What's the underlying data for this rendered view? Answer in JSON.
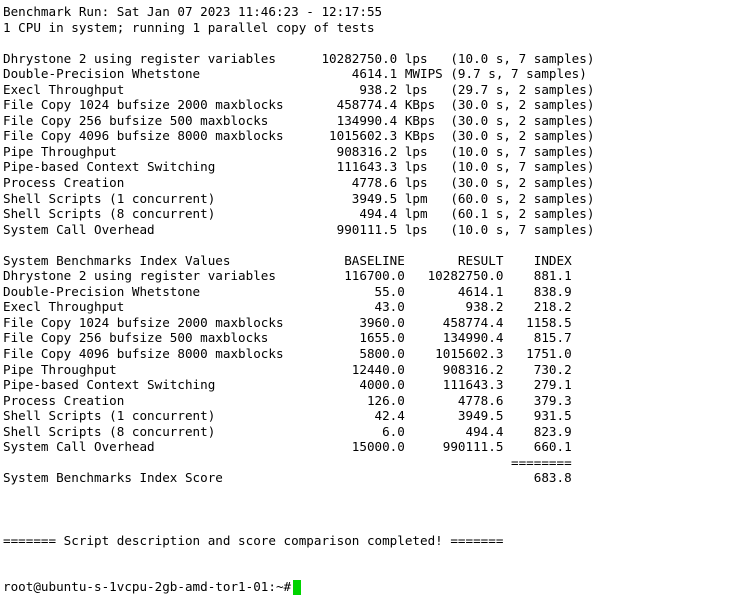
{
  "header": {
    "title": "Benchmark Run: Sat Jan 07 2023 11:46:23 - 12:17:55",
    "system": "1 CPU in system; running 1 parallel copy of tests"
  },
  "results": [
    {
      "name": "Dhrystone 2 using register variables",
      "value": "10282750.0",
      "unit": "lps",
      "meta": "(10.0 s, 7 samples)"
    },
    {
      "name": "Double-Precision Whetstone",
      "value": "4614.1",
      "unit": "MWIPS",
      "meta": "(9.7 s, 7 samples)"
    },
    {
      "name": "Execl Throughput",
      "value": "938.2",
      "unit": "lps",
      "meta": "(29.7 s, 2 samples)"
    },
    {
      "name": "File Copy 1024 bufsize 2000 maxblocks",
      "value": "458774.4",
      "unit": "KBps",
      "meta": "(30.0 s, 2 samples)"
    },
    {
      "name": "File Copy 256 bufsize 500 maxblocks",
      "value": "134990.4",
      "unit": "KBps",
      "meta": "(30.0 s, 2 samples)"
    },
    {
      "name": "File Copy 4096 bufsize 8000 maxblocks",
      "value": "1015602.3",
      "unit": "KBps",
      "meta": "(30.0 s, 2 samples)"
    },
    {
      "name": "Pipe Throughput",
      "value": "908316.2",
      "unit": "lps",
      "meta": "(10.0 s, 7 samples)"
    },
    {
      "name": "Pipe-based Context Switching",
      "value": "111643.3",
      "unit": "lps",
      "meta": "(10.0 s, 7 samples)"
    },
    {
      "name": "Process Creation",
      "value": "4778.6",
      "unit": "lps",
      "meta": "(30.0 s, 2 samples)"
    },
    {
      "name": "Shell Scripts (1 concurrent)",
      "value": "3949.5",
      "unit": "lpm",
      "meta": "(60.0 s, 2 samples)"
    },
    {
      "name": "Shell Scripts (8 concurrent)",
      "value": "494.4",
      "unit": "lpm",
      "meta": "(60.1 s, 2 samples)"
    },
    {
      "name": "System Call Overhead",
      "value": "990111.5",
      "unit": "lps",
      "meta": "(10.0 s, 7 samples)"
    }
  ],
  "index_table": {
    "title": "System Benchmarks Index Values",
    "col_baseline": "BASELINE",
    "col_result": "RESULT",
    "col_index": "INDEX",
    "rows": [
      {
        "name": "Dhrystone 2 using register variables",
        "baseline": "116700.0",
        "result": "10282750.0",
        "index": "881.1"
      },
      {
        "name": "Double-Precision Whetstone",
        "baseline": "55.0",
        "result": "4614.1",
        "index": "838.9"
      },
      {
        "name": "Execl Throughput",
        "baseline": "43.0",
        "result": "938.2",
        "index": "218.2"
      },
      {
        "name": "File Copy 1024 bufsize 2000 maxblocks",
        "baseline": "3960.0",
        "result": "458774.4",
        "index": "1158.5"
      },
      {
        "name": "File Copy 256 bufsize 500 maxblocks",
        "baseline": "1655.0",
        "result": "134990.4",
        "index": "815.7"
      },
      {
        "name": "File Copy 4096 bufsize 8000 maxblocks",
        "baseline": "5800.0",
        "result": "1015602.3",
        "index": "1751.0"
      },
      {
        "name": "Pipe Throughput",
        "baseline": "12440.0",
        "result": "908316.2",
        "index": "730.2"
      },
      {
        "name": "Pipe-based Context Switching",
        "baseline": "4000.0",
        "result": "111643.3",
        "index": "279.1"
      },
      {
        "name": "Process Creation",
        "baseline": "126.0",
        "result": "4778.6",
        "index": "379.3"
      },
      {
        "name": "Shell Scripts (1 concurrent)",
        "baseline": "42.4",
        "result": "3949.5",
        "index": "931.5"
      },
      {
        "name": "Shell Scripts (8 concurrent)",
        "baseline": "6.0",
        "result": "494.4",
        "index": "823.9"
      },
      {
        "name": "System Call Overhead",
        "baseline": "15000.0",
        "result": "990111.5",
        "index": "660.1"
      }
    ],
    "separator": "========",
    "score_label": "System Benchmarks Index Score",
    "score": "683.8"
  },
  "completion_message": "======= Script description and score comparison completed! =======",
  "prompt": "root@ubuntu-s-1vcpu-2gb-amd-tor1-01:~#",
  "colors": {
    "cursor": "#00d400",
    "background": "#ffffff",
    "text": "#000000"
  }
}
